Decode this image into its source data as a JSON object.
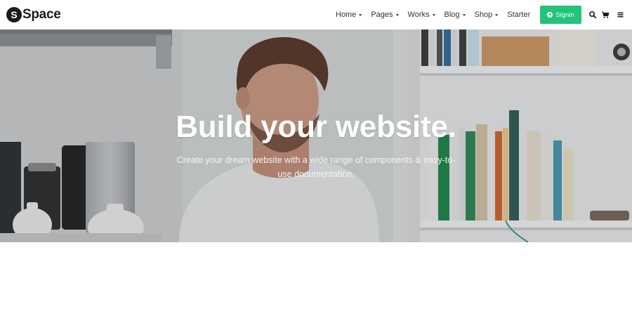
{
  "brand": {
    "mark": "S",
    "name": "Space"
  },
  "nav": {
    "items": [
      {
        "label": "Home",
        "dropdown": true
      },
      {
        "label": "Pages",
        "dropdown": true
      },
      {
        "label": "Works",
        "dropdown": true
      },
      {
        "label": "Blog",
        "dropdown": true
      },
      {
        "label": "Shop",
        "dropdown": true
      },
      {
        "label": "Starter",
        "dropdown": false
      }
    ],
    "signin_label": "Signin",
    "icons": [
      "search-icon",
      "cart-icon",
      "menu-icon"
    ]
  },
  "hero": {
    "title": "Build your website.",
    "subtitle": "Create your dream website with a wide range of components & easy-to-use documentation."
  },
  "colors": {
    "accent": "#22c47a",
    "brand_dark": "#1b1b1b",
    "hero_text": "#ffffff"
  }
}
